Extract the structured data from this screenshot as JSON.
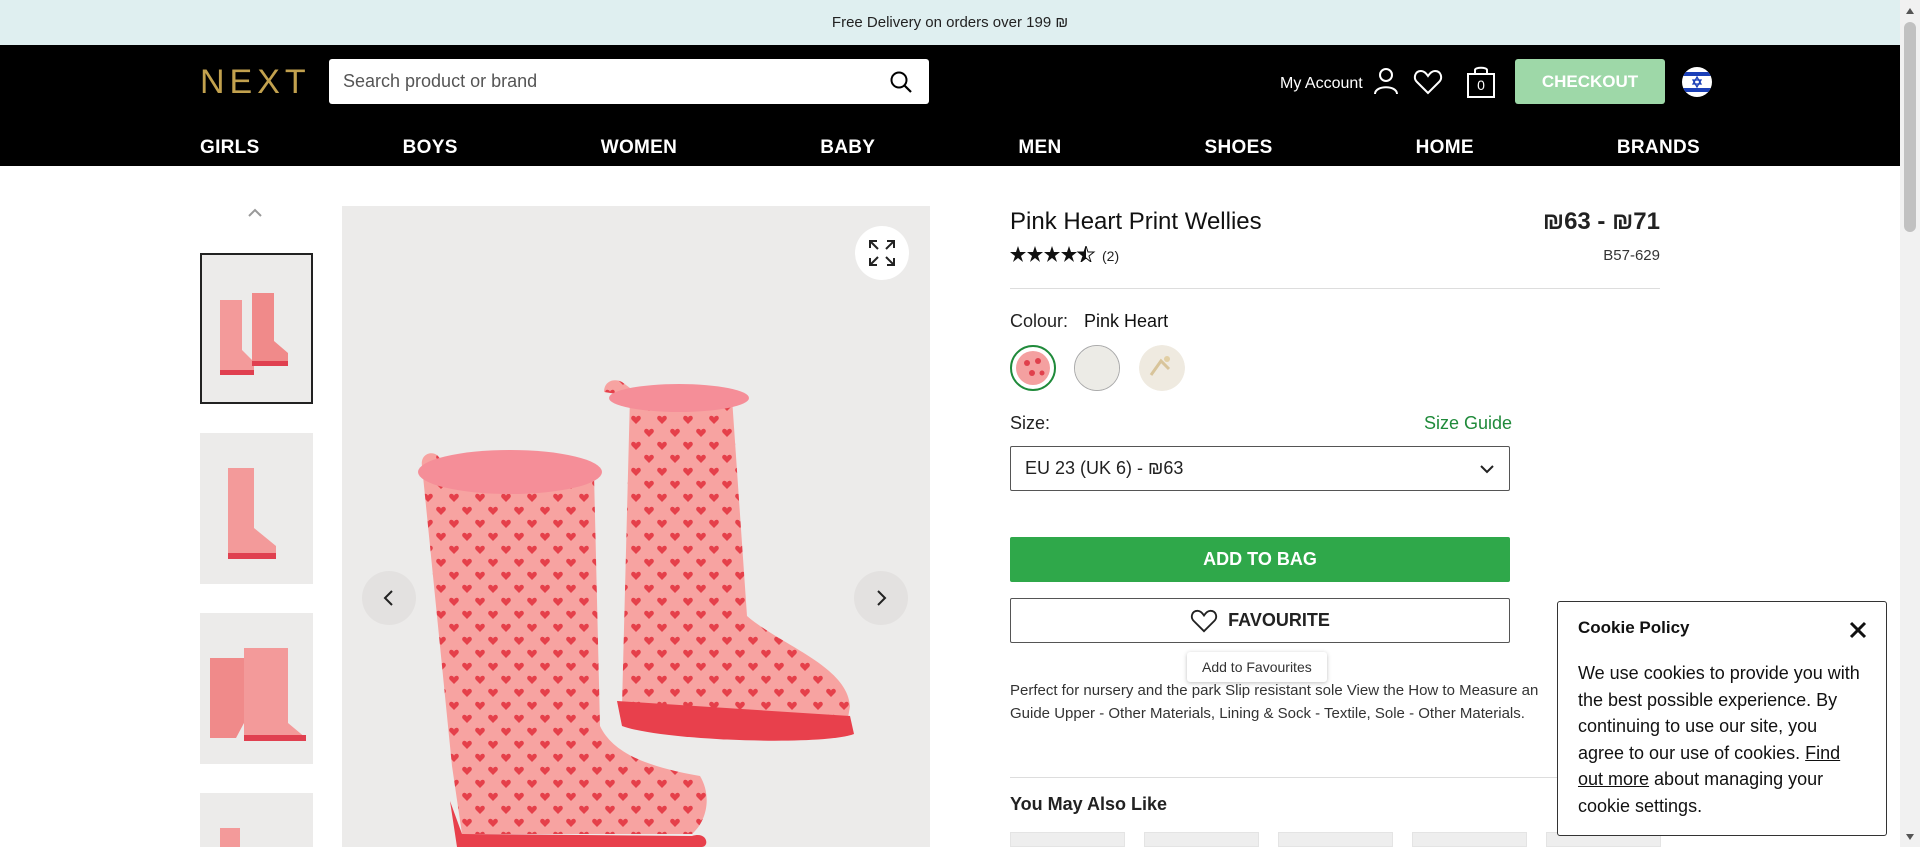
{
  "promo": {
    "text": "Free Delivery on orders over 199 ₪"
  },
  "header": {
    "logo": "NEXT",
    "search_placeholder": "Search product or brand",
    "account_label": "My Account",
    "bag_count": "0",
    "checkout_label": "CHECKOUT",
    "nav": [
      "GIRLS",
      "BOYS",
      "WOMEN",
      "BABY",
      "MEN",
      "SHOES",
      "HOME",
      "BRANDS"
    ]
  },
  "product": {
    "title": "Pink Heart Print Wellies",
    "price": "₪63 - ₪71",
    "rating": 4.5,
    "review_count": "(2)",
    "code": "B57-629",
    "colour_label": "Colour:",
    "colour_value": "Pink Heart",
    "size_label": "Size:",
    "size_guide": "Size Guide",
    "size_selected": "EU 23 (UK 6) - ₪63",
    "add_to_bag": "ADD TO BAG",
    "favourite": "FAVOURITE",
    "tooltip": "Add to Favourites",
    "description": "Perfect for nursery and the park Slip resistant sole View the How to Measure an Guide Upper - Other Materials, Lining & Sock - Textile, Sole - Other Materials.",
    "you_may_also_like": "You May Also Like"
  },
  "cookie": {
    "title": "Cookie Policy",
    "body": "We use cookies to provide you with the best possible experience. By continuing to use our site, you agree to our use of cookies.",
    "link": "Find out more",
    "tail": " about managing your cookie settings."
  },
  "colors": {
    "promo_bg": "#dfeff0",
    "header_bg": "#000000",
    "logo": "#c2a14e",
    "checkout_bg": "#9ed8a8",
    "add_to_bag_bg": "#2fa84a",
    "size_guide": "#1f8a3a"
  }
}
